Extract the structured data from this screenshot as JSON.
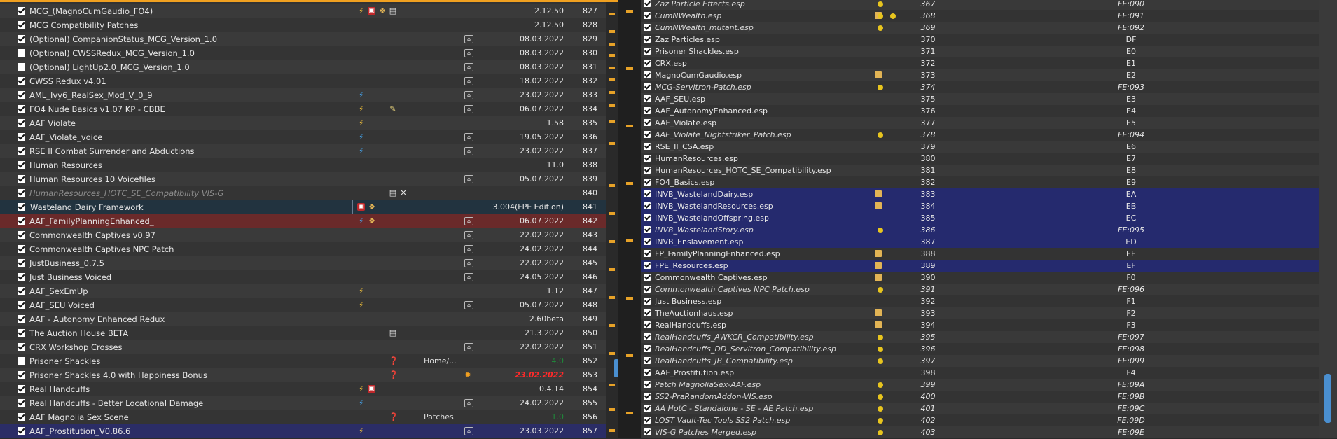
{
  "left_mods": [
    {
      "name": "MCG_(MagnoCumGaudio_FO4)",
      "checked": true,
      "icons": [
        "bolt",
        "red",
        "pkg",
        "doc"
      ],
      "category": "",
      "summary": false,
      "version": "2.12.50",
      "priority": "827",
      "style": ""
    },
    {
      "name": "MCG Compatibility Patches",
      "checked": true,
      "icons": [],
      "category": "",
      "summary": false,
      "version": "2.12.50",
      "priority": "828",
      "style": ""
    },
    {
      "name": "(Optional) CompanionStatus_MCG_Version_1.0",
      "checked": true,
      "icons": [],
      "category": "",
      "summary": true,
      "version": "08.03.2022",
      "priority": "829",
      "style": ""
    },
    {
      "name": "(Optional) CWSSRedux_MCG_Version_1.0",
      "checked": false,
      "icons": [],
      "category": "",
      "summary": true,
      "version": "08.03.2022",
      "priority": "830",
      "style": ""
    },
    {
      "name": "(Optional) LightUp2.0_MCG_Version_1.0",
      "checked": false,
      "icons": [],
      "category": "",
      "summary": true,
      "version": "08.03.2022",
      "priority": "831",
      "style": ""
    },
    {
      "name": "CWSS Redux v4.01",
      "checked": true,
      "icons": [],
      "category": "",
      "summary": true,
      "version": "18.02.2022",
      "priority": "832",
      "style": ""
    },
    {
      "name": "AML_Ivy6_RealSex_Mod_V_0_9",
      "checked": true,
      "icons": [
        "bolt2"
      ],
      "category": "",
      "summary": true,
      "version": "23.02.2022",
      "priority": "833",
      "style": ""
    },
    {
      "name": "FO4 Nude Basics v1.07 KP - CBBE",
      "checked": true,
      "icons": [
        "bolt",
        "",
        "",
        "note"
      ],
      "category": "",
      "summary": true,
      "version": "06.07.2022",
      "priority": "834",
      "style": ""
    },
    {
      "name": "AAF Violate",
      "checked": true,
      "icons": [
        "bolt"
      ],
      "category": "",
      "summary": false,
      "version": "1.58",
      "priority": "835",
      "style": ""
    },
    {
      "name": "AAF_Violate_voice",
      "checked": true,
      "icons": [
        "bolt2"
      ],
      "category": "",
      "summary": true,
      "version": "19.05.2022",
      "priority": "836",
      "style": ""
    },
    {
      "name": "RSE II Combat Surrender and Abductions",
      "checked": true,
      "icons": [
        "bolt2"
      ],
      "category": "",
      "summary": true,
      "version": "23.02.2022",
      "priority": "837",
      "style": ""
    },
    {
      "name": "Human Resources",
      "checked": true,
      "icons": [],
      "category": "",
      "summary": false,
      "version": "11.0",
      "priority": "838",
      "style": ""
    },
    {
      "name": "Human Resources 10 Voicefiles",
      "checked": true,
      "icons": [],
      "category": "",
      "summary": true,
      "version": "05.07.2022",
      "priority": "839",
      "style": ""
    },
    {
      "name": "HumanResources_HOTC_SE_Compatibility VIS-G",
      "checked": true,
      "icons": [
        "",
        "",
        "",
        "doc",
        "x"
      ],
      "category": "",
      "summary": false,
      "version": "",
      "priority": "840",
      "style": "dis"
    },
    {
      "name": "Wasteland Dairy Framework",
      "checked": true,
      "icons": [
        "red",
        "pkg"
      ],
      "category": "",
      "summary": false,
      "version": "3.004(FPE Edition)",
      "priority": "841",
      "style": "sel"
    },
    {
      "name": "AAF_FamilyPlanningEnhanced_",
      "checked": true,
      "icons": [
        "bolt2",
        "pkg"
      ],
      "category": "",
      "summary": true,
      "version": "06.07.2022",
      "priority": "842",
      "style": "red"
    },
    {
      "name": "Commonwealth Captives v0.97",
      "checked": true,
      "icons": [],
      "category": "",
      "summary": true,
      "version": "22.02.2022",
      "priority": "843",
      "style": ""
    },
    {
      "name": "Commonwealth Captives NPC Patch",
      "checked": true,
      "icons": [],
      "category": "",
      "summary": true,
      "version": "24.02.2022",
      "priority": "844",
      "style": ""
    },
    {
      "name": "JustBusiness_0.7.5",
      "checked": true,
      "icons": [],
      "category": "",
      "summary": true,
      "version": "22.02.2022",
      "priority": "845",
      "style": ""
    },
    {
      "name": "Just Business Voiced",
      "checked": true,
      "icons": [],
      "category": "",
      "summary": true,
      "version": "24.05.2022",
      "priority": "846",
      "style": ""
    },
    {
      "name": "AAF_SexEmUp",
      "checked": true,
      "icons": [
        "bolt"
      ],
      "category": "",
      "summary": false,
      "version": "1.12",
      "priority": "847",
      "style": ""
    },
    {
      "name": "AAF_SEU Voiced",
      "checked": true,
      "icons": [
        "bolt"
      ],
      "category": "",
      "summary": true,
      "version": "05.07.2022",
      "priority": "848",
      "style": ""
    },
    {
      "name": "AAF - Autonomy Enhanced Redux",
      "checked": true,
      "icons": [],
      "category": "",
      "summary": false,
      "version": "2.60beta",
      "priority": "849",
      "style": ""
    },
    {
      "name": "The Auction House BETA",
      "checked": true,
      "icons": [
        "",
        "",
        "",
        "doc"
      ],
      "category": "",
      "summary": false,
      "version": "21.3.2022",
      "priority": "850",
      "style": ""
    },
    {
      "name": "CRX Workshop Crosses",
      "checked": true,
      "icons": [],
      "category": "",
      "summary": true,
      "version": "22.02.2022",
      "priority": "851",
      "style": ""
    },
    {
      "name": "Prisoner Shackles",
      "checked": false,
      "icons": [
        "",
        "",
        "",
        "q"
      ],
      "category": "Home/...",
      "summary": false,
      "version": "4.0",
      "priority": "852",
      "style": "",
      "vstyle": "green"
    },
    {
      "name": "Prisoner Shackles 4.0 with Happiness Bonus",
      "checked": true,
      "icons": [
        "",
        "",
        "",
        "q"
      ],
      "category": "",
      "summary": false,
      "star": true,
      "version": "23.02.2022",
      "priority": "853",
      "style": "",
      "vstyle": "date-red"
    },
    {
      "name": "Real Handcuffs",
      "checked": true,
      "icons": [
        "bolt",
        "red"
      ],
      "category": "",
      "summary": false,
      "version": "0.4.14",
      "priority": "854",
      "style": ""
    },
    {
      "name": "Real Handcuffs - Better Locational Damage",
      "checked": true,
      "icons": [
        "bolt2"
      ],
      "category": "",
      "summary": true,
      "version": "24.02.2022",
      "priority": "855",
      "style": ""
    },
    {
      "name": "AAF Magnolia Sex Scene",
      "checked": true,
      "icons": [
        "",
        "",
        "",
        "q"
      ],
      "category": "Patches",
      "summary": false,
      "version": "1.0",
      "priority": "856",
      "style": "",
      "vstyle": "green"
    },
    {
      "name": "AAF_Prostitution_V0.86.6",
      "checked": true,
      "icons": [
        "bolt"
      ],
      "category": "",
      "summary": true,
      "version": "23.03.2022",
      "priority": "857",
      "style": "blue"
    }
  ],
  "plugins": [
    {
      "name": "Zaz Particle Effects.esp",
      "italic": true,
      "icon": false,
      "dot": 1,
      "index": "367",
      "formid": "FE:090",
      "style": ""
    },
    {
      "name": "CumNWealth.esp",
      "italic": true,
      "icon": true,
      "dot": 2,
      "index": "368",
      "formid": "FE:091",
      "style": ""
    },
    {
      "name": "CumNWealth_mutant.esp",
      "italic": true,
      "icon": false,
      "dot": 1,
      "index": "369",
      "formid": "FE:092",
      "style": ""
    },
    {
      "name": "Zaz Particles.esp",
      "italic": false,
      "icon": false,
      "dot": 0,
      "index": "370",
      "formid": "DF",
      "style": ""
    },
    {
      "name": "Prisoner Shackles.esp",
      "italic": false,
      "icon": false,
      "dot": 0,
      "index": "371",
      "formid": "E0",
      "style": ""
    },
    {
      "name": "CRX.esp",
      "italic": false,
      "icon": false,
      "dot": 0,
      "index": "372",
      "formid": "E1",
      "style": ""
    },
    {
      "name": "MagnoCumGaudio.esp",
      "italic": false,
      "icon": true,
      "dot": 0,
      "index": "373",
      "formid": "E2",
      "style": ""
    },
    {
      "name": "MCG-Servitron-Patch.esp",
      "italic": true,
      "icon": false,
      "dot": 1,
      "index": "374",
      "formid": "FE:093",
      "style": ""
    },
    {
      "name": "AAF_SEU.esp",
      "italic": false,
      "icon": false,
      "dot": 0,
      "index": "375",
      "formid": "E3",
      "style": ""
    },
    {
      "name": "AAF_AutonomyEnhanced.esp",
      "italic": false,
      "icon": false,
      "dot": 0,
      "index": "376",
      "formid": "E4",
      "style": ""
    },
    {
      "name": "AAF_Violate.esp",
      "italic": false,
      "icon": false,
      "dot": 0,
      "index": "377",
      "formid": "E5",
      "style": ""
    },
    {
      "name": "AAF_Violate_Nightstriker_Patch.esp",
      "italic": true,
      "icon": false,
      "dot": 1,
      "index": "378",
      "formid": "FE:094",
      "style": ""
    },
    {
      "name": "RSE_II_CSA.esp",
      "italic": false,
      "icon": false,
      "dot": 0,
      "index": "379",
      "formid": "E6",
      "style": ""
    },
    {
      "name": "HumanResources.esp",
      "italic": false,
      "icon": false,
      "dot": 0,
      "index": "380",
      "formid": "E7",
      "style": ""
    },
    {
      "name": "HumanResources_HOTC_SE_Compatibility.esp",
      "italic": false,
      "icon": false,
      "dot": 0,
      "index": "381",
      "formid": "E8",
      "style": ""
    },
    {
      "name": "FO4_Basics.esp",
      "italic": false,
      "icon": false,
      "dot": 0,
      "index": "382",
      "formid": "E9",
      "style": ""
    },
    {
      "name": "INVB_WastelandDairy.esp",
      "italic": false,
      "icon": true,
      "dot": 0,
      "index": "383",
      "formid": "EA",
      "style": "blue"
    },
    {
      "name": "INVB_WastelandResources.esp",
      "italic": false,
      "icon": true,
      "dot": 0,
      "index": "384",
      "formid": "EB",
      "style": "blue"
    },
    {
      "name": "INVB_WastelandOffspring.esp",
      "italic": false,
      "icon": false,
      "dot": 0,
      "index": "385",
      "formid": "EC",
      "style": "blue"
    },
    {
      "name": "INVB_WastelandStory.esp",
      "italic": true,
      "icon": false,
      "dot": 1,
      "index": "386",
      "formid": "FE:095",
      "style": "blue"
    },
    {
      "name": "INVB_Enslavement.esp",
      "italic": false,
      "icon": false,
      "dot": 0,
      "index": "387",
      "formid": "ED",
      "style": "blue"
    },
    {
      "name": "FP_FamilyPlanningEnhanced.esp",
      "italic": false,
      "icon": true,
      "dot": 0,
      "index": "388",
      "formid": "EE",
      "style": ""
    },
    {
      "name": "FPE_Resources.esp",
      "italic": false,
      "icon": true,
      "dot": 0,
      "index": "389",
      "formid": "EF",
      "style": "blue"
    },
    {
      "name": "Commonwealth Captives.esp",
      "italic": false,
      "icon": true,
      "dot": 0,
      "index": "390",
      "formid": "F0",
      "style": ""
    },
    {
      "name": "Commonwealth Captives NPC Patch.esp",
      "italic": true,
      "icon": false,
      "dot": 1,
      "index": "391",
      "formid": "FE:096",
      "style": ""
    },
    {
      "name": "Just Business.esp",
      "italic": false,
      "icon": false,
      "dot": 0,
      "index": "392",
      "formid": "F1",
      "style": ""
    },
    {
      "name": "TheAuctionhaus.esp",
      "italic": false,
      "icon": true,
      "dot": 0,
      "index": "393",
      "formid": "F2",
      "style": ""
    },
    {
      "name": "RealHandcuffs.esp",
      "italic": false,
      "icon": true,
      "dot": 0,
      "index": "394",
      "formid": "F3",
      "style": ""
    },
    {
      "name": "RealHandcuffs_AWKCR_Compatibility.esp",
      "italic": true,
      "icon": false,
      "dot": 1,
      "index": "395",
      "formid": "FE:097",
      "style": ""
    },
    {
      "name": "RealHandcuffs_DD_Servitron_Compatibility.esp",
      "italic": true,
      "icon": false,
      "dot": 1,
      "index": "396",
      "formid": "FE:098",
      "style": ""
    },
    {
      "name": "RealHandcuffs_JB_Compatibility.esp",
      "italic": true,
      "icon": false,
      "dot": 1,
      "index": "397",
      "formid": "FE:099",
      "style": ""
    },
    {
      "name": "AAF_Prostitution.esp",
      "italic": false,
      "icon": false,
      "dot": 0,
      "index": "398",
      "formid": "F4",
      "style": ""
    },
    {
      "name": "Patch MagnoliaSex-AAF.esp",
      "italic": true,
      "icon": false,
      "dot": 1,
      "index": "399",
      "formid": "FE:09A",
      "style": ""
    },
    {
      "name": "SS2-PraRandomAddon-VIS.esp",
      "italic": true,
      "icon": false,
      "dot": 1,
      "index": "400",
      "formid": "FE:09B",
      "style": ""
    },
    {
      "name": "AA HotC - Standalone - SE - AE Patch.esp",
      "italic": true,
      "icon": false,
      "dot": 1,
      "index": "401",
      "formid": "FE:09C",
      "style": ""
    },
    {
      "name": "LOST Vault-Tec Tools SS2 Patch.esp",
      "italic": true,
      "icon": false,
      "dot": 1,
      "index": "402",
      "formid": "FE:09D",
      "style": ""
    },
    {
      "name": "VIS-G Patches Merged.esp",
      "italic": true,
      "icon": false,
      "dot": 1,
      "index": "403",
      "formid": "FE:09E",
      "style": ""
    }
  ]
}
